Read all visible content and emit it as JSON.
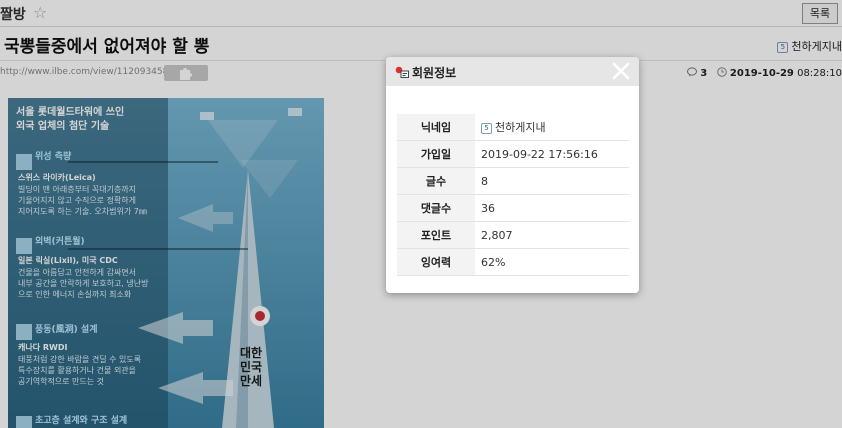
{
  "topbar": {
    "board_name": "짤방",
    "star_icon": "star-icon",
    "list_button": "목록"
  },
  "post": {
    "title": "국뽕들중에서 없어져야 할 뽕",
    "author": "천하게지내",
    "url": "http://www.ilbe.com/view/11209345856",
    "comment_count": "3",
    "date": "2019-10-29",
    "time": "08:28:10"
  },
  "content_image": {
    "heading_1": "서울 롯데월드타워에 쓰인",
    "heading_2": "외국 업체의 첨단 기술",
    "sections": [
      {
        "title": "위성 측량",
        "company": "스위스 라이카(Leica)",
        "lines": [
          "빌딩이 맨 아래층부터 꼭대기층까지",
          "기울어지지 않고 수직으로 정확하게",
          "지어지도록 하는 기술. 오차범위가 7㎜"
        ]
      },
      {
        "title": "외벽(커튼월)",
        "company": "일본 릭실(Lixil), 미국 CDC",
        "lines": [
          "건물을 아름답고 안전하게 감싸면서",
          "내부 공간을 안락하게 보호하고, 냉난방",
          "으로 인한 에너지 손실까지 최소화"
        ]
      },
      {
        "title": "풍동(風洞) 설계",
        "company": "캐나다 RWDI",
        "lines": [
          "태풍처럼 강한 바람을 견딜 수 있도록",
          "특수장치를 활용하거나 건물 외관을",
          "공기역학적으로 만드는 것"
        ]
      },
      {
        "title": "초고층 설계와 구조 설계",
        "company": "",
        "lines": []
      }
    ],
    "calligraphy": "대한민국 만세"
  },
  "modal": {
    "title": "회원정보",
    "rows": [
      {
        "label": "닉네임",
        "value": "천하게지내"
      },
      {
        "label": "가입일",
        "value": "2019-09-22 17:56:16"
      },
      {
        "label": "글수",
        "value": "8"
      },
      {
        "label": "댓글수",
        "value": "36"
      },
      {
        "label": "포인트",
        "value": "2,807"
      },
      {
        "label": "잉여력",
        "value": "62%"
      }
    ]
  },
  "colors": {
    "overlay": "#000000",
    "modal_header": "#e6e6e6",
    "icon_red": "#d6322e",
    "content_bg": "#2d6e8c"
  }
}
